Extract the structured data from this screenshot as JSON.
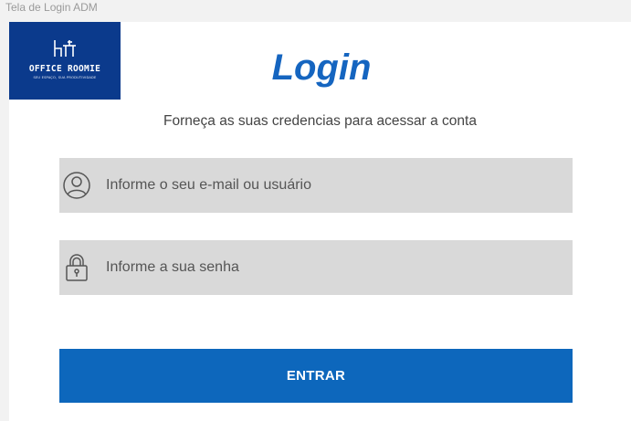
{
  "frame": {
    "label": "Tela de Login ADM"
  },
  "logo": {
    "name": "OFFICE ROOMIE",
    "tagline": "SEU ESPAÇO, SUA PRODUTIVIDADE"
  },
  "header": {
    "title": "Login"
  },
  "instructions": {
    "text": "Forneça as suas credencias para acessar a conta"
  },
  "form": {
    "email": {
      "placeholder": "Informe o seu e-mail ou usuário",
      "value": "",
      "icon": "user-icon"
    },
    "password": {
      "placeholder": "Informe a sua senha",
      "value": "",
      "icon": "lock-icon"
    },
    "submit_label": "ENTRAR"
  },
  "colors": {
    "brand": "#0b3a8c",
    "accent": "#1565c0",
    "button": "#0d67bc",
    "field_bg": "#d9d9d9"
  }
}
